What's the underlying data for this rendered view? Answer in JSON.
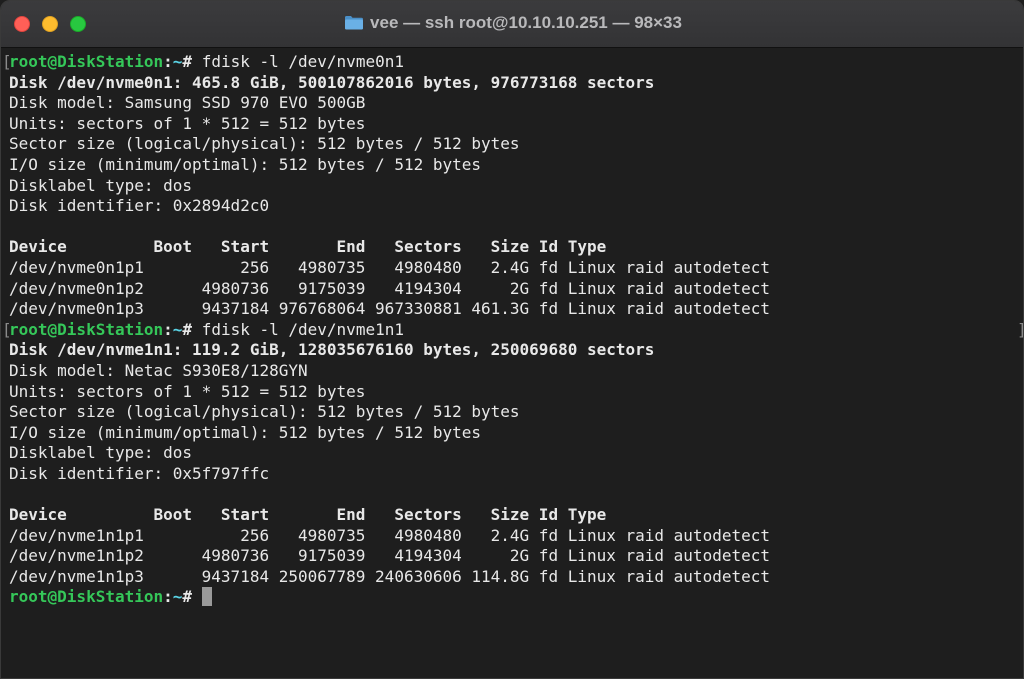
{
  "window": {
    "title": "vee — ssh root@10.10.10.251 — 98×33",
    "icon": "folder-icon"
  },
  "colors": {
    "background": "#1e1e1e",
    "prompt_user": "#35c759",
    "prompt_path": "#5ad4e6",
    "text": "#e8e8e8"
  },
  "prompt": {
    "user_host": "root@DiskStation",
    "colon": ":",
    "path": "~",
    "symbol": "#"
  },
  "commands": [
    {
      "command": "fdisk -l /dev/nvme0n1",
      "disk_header": "Disk /dev/nvme0n1: 465.8 GiB, 500107862016 bytes, 976773168 sectors",
      "info": [
        "Disk model: Samsung SSD 970 EVO 500GB",
        "Units: sectors of 1 * 512 = 512 bytes",
        "Sector size (logical/physical): 512 bytes / 512 bytes",
        "I/O size (minimum/optimal): 512 bytes / 512 bytes",
        "Disklabel type: dos",
        "Disk identifier: 0x2894d2c0"
      ],
      "table_header": "Device         Boot   Start       End   Sectors   Size Id Type",
      "rows": [
        "/dev/nvme0n1p1          256   4980735   4980480   2.4G fd Linux raid autodetect",
        "/dev/nvme0n1p2      4980736   9175039   4194304     2G fd Linux raid autodetect",
        "/dev/nvme0n1p3      9437184 976768064 967330881 461.3G fd Linux raid autodetect"
      ]
    },
    {
      "command": "fdisk -l /dev/nvme1n1",
      "disk_header": "Disk /dev/nvme1n1: 119.2 GiB, 128035676160 bytes, 250069680 sectors",
      "info": [
        "Disk model: Netac S930E8/128GYN",
        "Units: sectors of 1 * 512 = 512 bytes",
        "Sector size (logical/physical): 512 bytes / 512 bytes",
        "I/O size (minimum/optimal): 512 bytes / 512 bytes",
        "Disklabel type: dos",
        "Disk identifier: 0x5f797ffc"
      ],
      "table_header": "Device         Boot   Start       End   Sectors   Size Id Type",
      "rows": [
        "/dev/nvme1n1p1          256   4980735   4980480   2.4G fd Linux raid autodetect",
        "/dev/nvme1n1p2      4980736   9175039   4194304     2G fd Linux raid autodetect",
        "/dev/nvme1n1p3      9437184 250067789 240630606 114.8G fd Linux raid autodetect"
      ]
    }
  ]
}
